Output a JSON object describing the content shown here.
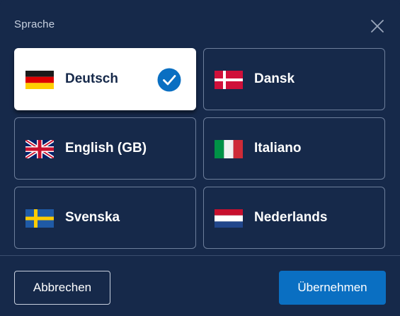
{
  "dialog": {
    "title": "Sprache",
    "close_icon": "close-icon"
  },
  "languages": [
    {
      "label": "Deutsch",
      "flag": "flag-germany-icon",
      "selected": true
    },
    {
      "label": "Dansk",
      "flag": "flag-denmark-icon",
      "selected": false
    },
    {
      "label": "English (GB)",
      "flag": "flag-uk-icon",
      "selected": false
    },
    {
      "label": "Italiano",
      "flag": "flag-italy-icon",
      "selected": false
    },
    {
      "label": "Svenska",
      "flag": "flag-sweden-icon",
      "selected": false
    },
    {
      "label": "Nederlands",
      "flag": "flag-netherlands-icon",
      "selected": false
    }
  ],
  "footer": {
    "cancel_label": "Abbrechen",
    "confirm_label": "Übernehmen"
  },
  "colors": {
    "background": "#16294a",
    "selected_card": "#ffffff",
    "accent": "#0a6fc2",
    "card_border": "#6d7e9b"
  }
}
